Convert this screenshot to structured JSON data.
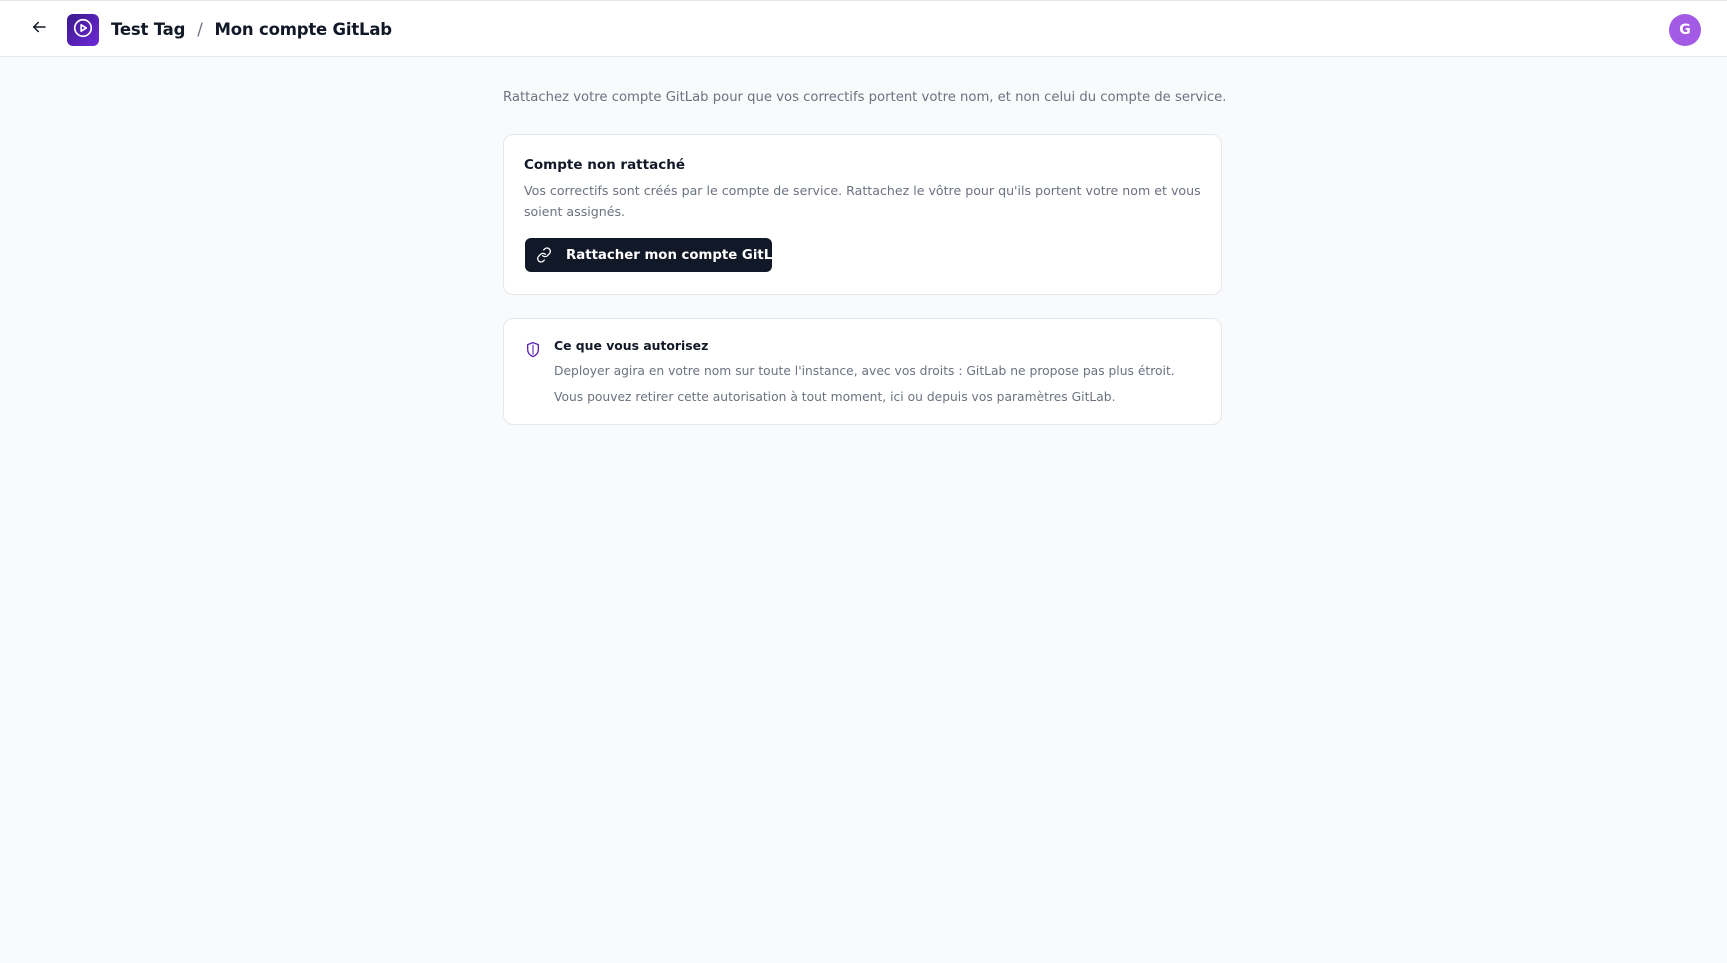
{
  "header": {
    "back_icon": "arrow-left-icon",
    "logo_icon": "play-circle-icon",
    "breadcrumb": {
      "project": "Test Tag",
      "separator": "/",
      "current": "Mon compte GitLab"
    },
    "avatar_initial": "G",
    "avatar_color": "#a35be6"
  },
  "intro": "Rattachez votre compte GitLab pour que vos correctifs portent votre nom, et non celui du compte de service.",
  "status_card": {
    "title": "Compte non rattaché",
    "description": "Vos correctifs sont créés par le compte de service. Rattachez le vôtre pour qu'ils portent votre nom et vous soient assignés.",
    "button_label": "Rattacher mon compte GitLab",
    "button_icon": "link-icon"
  },
  "permissions_card": {
    "icon": "shield-icon",
    "title": "Ce que vous autorisez",
    "lines": [
      "Deployer agira en votre nom sur toute l'instance, avec vos droits : GitLab ne propose pas plus étroit.",
      "Vous pouvez retirer cette autorisation à tout moment, ici ou depuis vos paramètres GitLab."
    ]
  },
  "colors": {
    "accent": "#6d28d9",
    "button_bg": "#111827",
    "background": "#f9fafb"
  }
}
